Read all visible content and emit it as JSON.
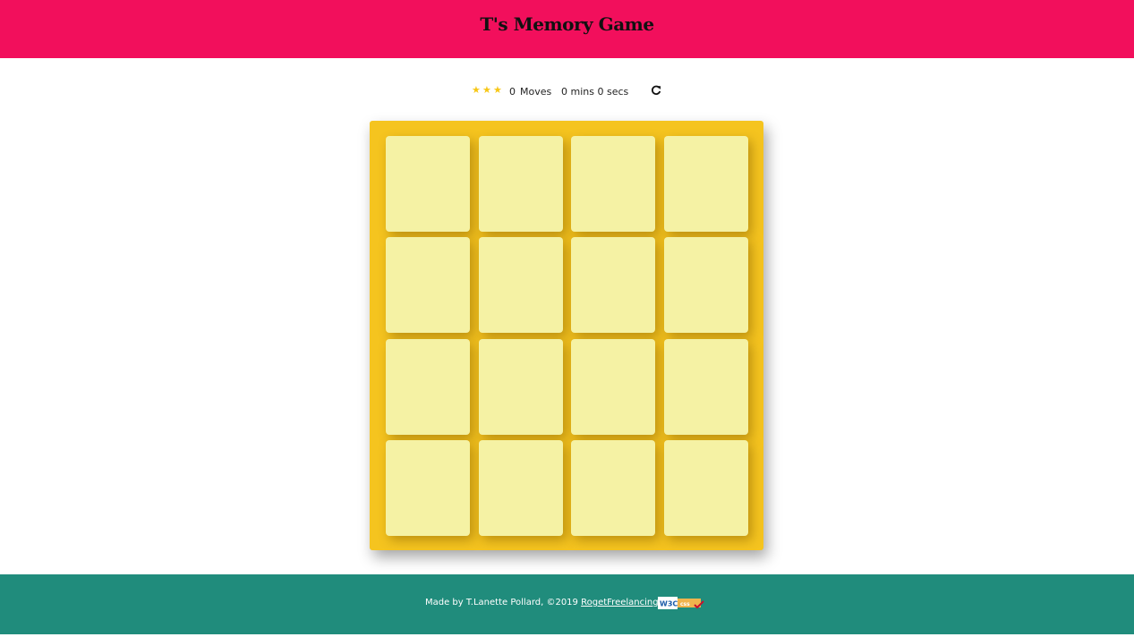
{
  "header": {
    "title": "T's Memory Game",
    "background_color": "#f20f5c"
  },
  "score_panel": {
    "stars": [
      "star-icon",
      "star-icon",
      "star-icon"
    ],
    "star_color": "#f7c716",
    "moves": "0",
    "moves_label": "Moves",
    "timer": "0 mins 0 secs",
    "restart_icon": "restart-icon"
  },
  "deck": {
    "background_color": "#f5c41f",
    "card_color": "#f5f2a4",
    "rows": 4,
    "columns": 4,
    "cards_face_down": 16
  },
  "footer": {
    "background_color": "#208c7c",
    "credit_text": "Made by T.Lanette Pollard, ©2019",
    "link_text": "RogetFreelancing",
    "badge_icon": "w3c-css-validator-badge"
  }
}
